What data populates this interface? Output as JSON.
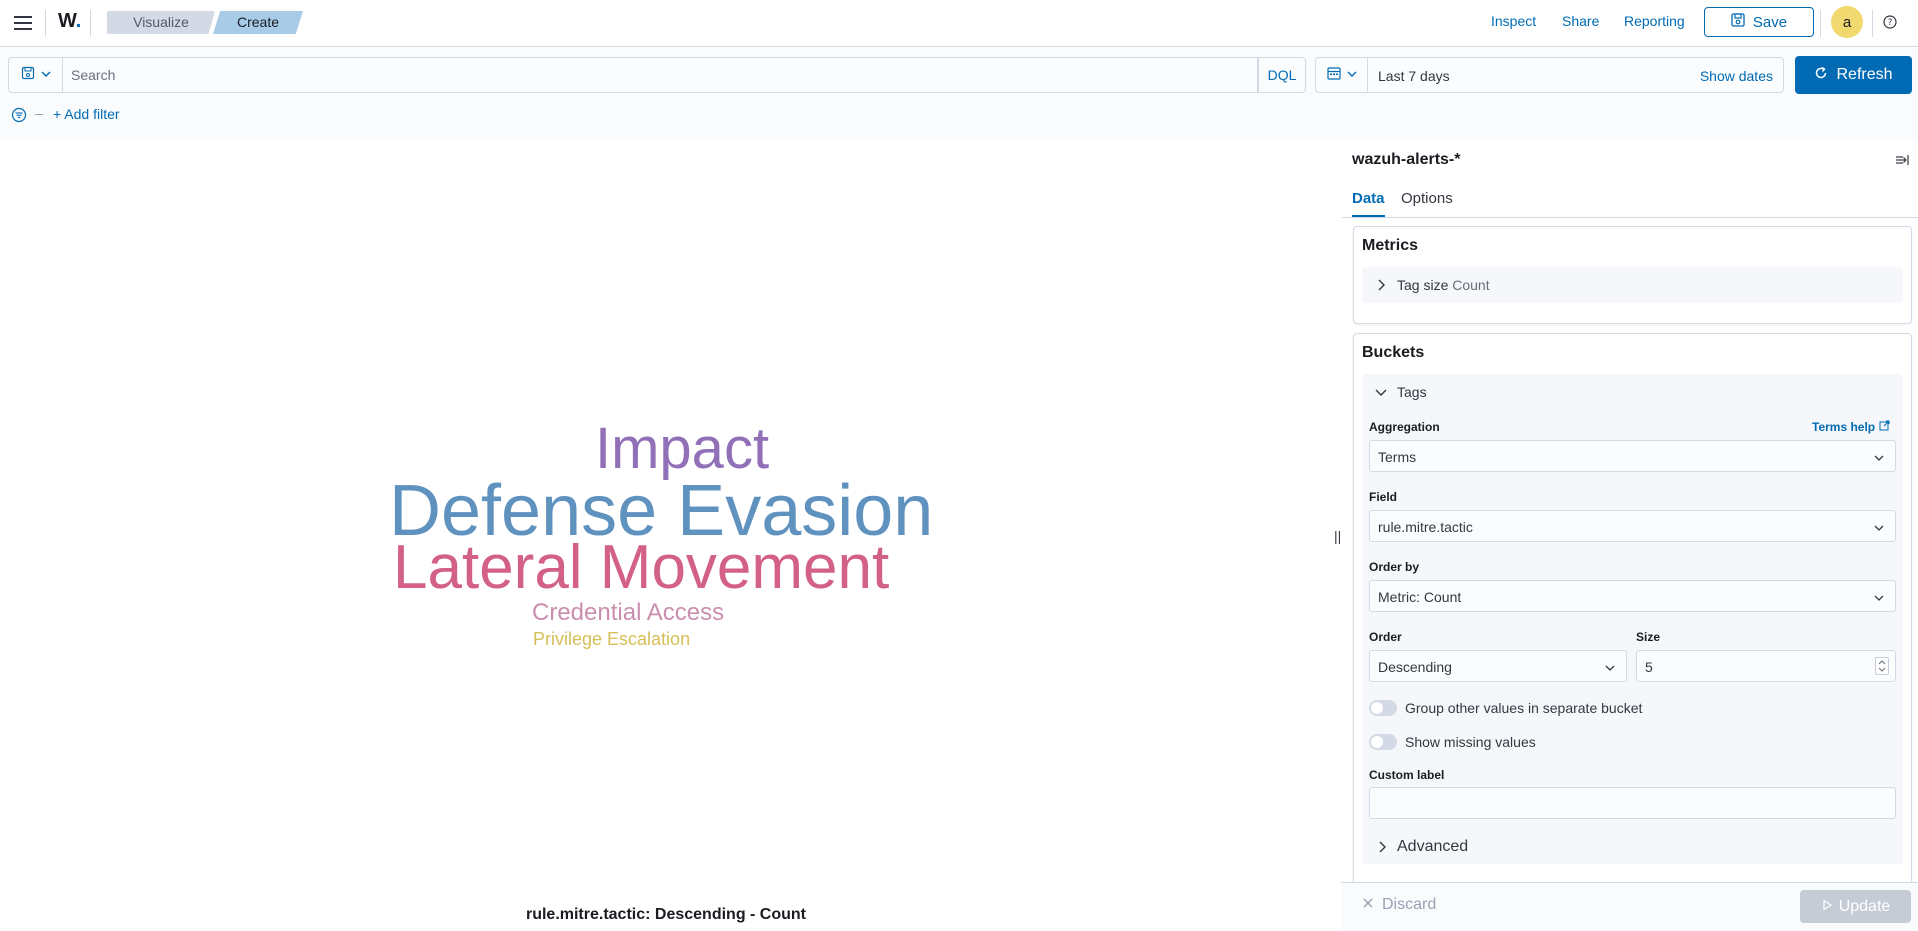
{
  "header": {
    "logo": "W",
    "logo_dot": ".",
    "breadcrumbs": [
      {
        "label": "Visualize"
      },
      {
        "label": "Create"
      }
    ],
    "links": {
      "inspect": "Inspect",
      "share": "Share",
      "reporting": "Reporting"
    },
    "save_label": "Save",
    "avatar_initial": "a",
    "icons": {
      "menu": "hamburger-menu-icon",
      "save": "save-icon",
      "help": "help-icon"
    }
  },
  "query": {
    "search_placeholder": "Search",
    "search_value": "",
    "language_label": "DQL",
    "date_range": "Last 7 days",
    "show_dates_label": "Show dates",
    "refresh_label": "Refresh",
    "add_filter_label": "+ Add filter"
  },
  "visualization": {
    "type": "tagcloud",
    "tags": [
      {
        "text": "Impact",
        "color": "#9170b8"
      },
      {
        "text": "Defense Evasion",
        "color": "#6092c0"
      },
      {
        "text": "Lateral Movement",
        "color": "#d36086"
      },
      {
        "text": "Credential Access",
        "color": "#ca8eae"
      },
      {
        "text": "Privilege Escalation",
        "color": "#d6bf57"
      }
    ],
    "caption": "rule.mitre.tactic: Descending - Count"
  },
  "sidebar": {
    "index_pattern": "wazuh-alerts-*",
    "tabs": [
      {
        "label": "Data",
        "active": true
      },
      {
        "label": "Options",
        "active": false
      }
    ],
    "metrics": {
      "title": "Metrics",
      "row_label": "Tag size",
      "row_sub": "Count"
    },
    "buckets": {
      "title": "Buckets",
      "row_label": "Tags",
      "aggregation_label": "Aggregation",
      "terms_help_label": "Terms help",
      "aggregation_value": "Terms",
      "field_label": "Field",
      "field_value": "rule.mitre.tactic",
      "order_by_label": "Order by",
      "order_by_value": "Metric: Count",
      "order_label": "Order",
      "order_value": "Descending",
      "size_label": "Size",
      "size_value": "5",
      "group_other_label": "Group other values in separate bucket",
      "show_missing_label": "Show missing values",
      "custom_label_label": "Custom label",
      "custom_label_value": "",
      "advanced_label": "Advanced"
    },
    "footer": {
      "discard_label": "Discard",
      "update_label": "Update"
    }
  },
  "colors": {
    "primary": "#006bb4",
    "border": "#d3dae6",
    "avatar": "#f1d86f"
  }
}
